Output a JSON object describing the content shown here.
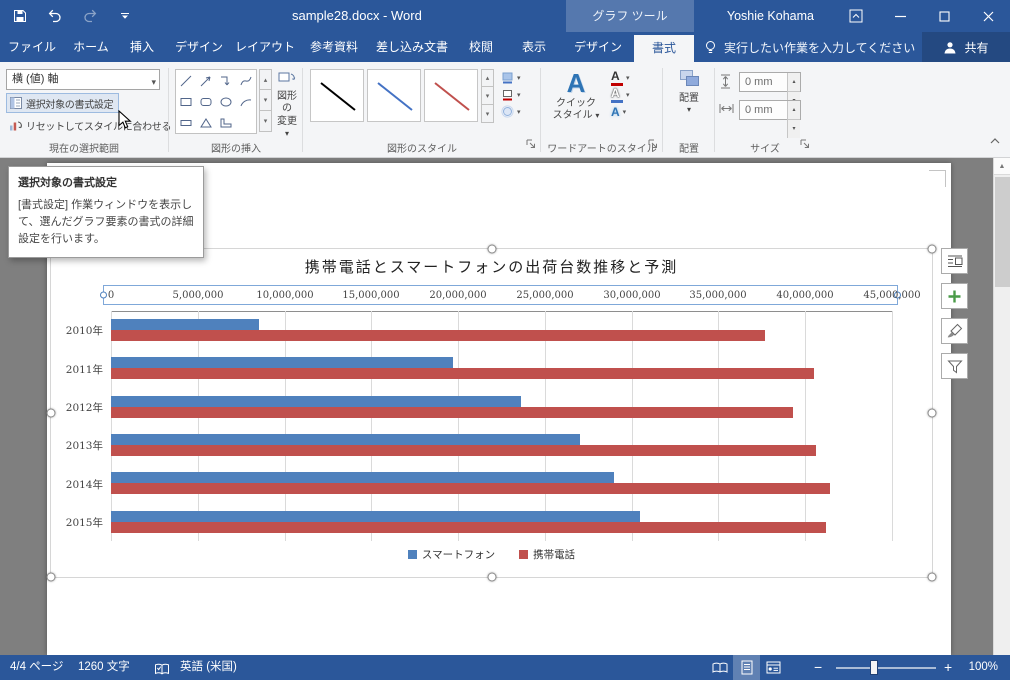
{
  "titlebar": {
    "title": "sample28.docx - Word",
    "contextual_header": "グラフ ツール",
    "user": "Yoshie Kohama"
  },
  "tabs": [
    {
      "label": "ファイル"
    },
    {
      "label": "ホーム"
    },
    {
      "label": "挿入"
    },
    {
      "label": "デザイン"
    },
    {
      "label": "レイアウト"
    },
    {
      "label": "参考資料"
    },
    {
      "label": "差し込み文書"
    },
    {
      "label": "校閲"
    },
    {
      "label": "表示"
    },
    {
      "label": "デザイン"
    },
    {
      "label": "書式"
    }
  ],
  "search": {
    "tell_me": "実行したい作業を入力してください"
  },
  "share": {
    "label": "共有"
  },
  "ribbon": {
    "current_selection": {
      "combo_value": "横 (値) 軸",
      "format_selection_label": "選択対象の書式設定",
      "reset_label": "リセットしてスタイルに合わせる",
      "group_label": "現在の選択範囲"
    },
    "insert_shapes": {
      "change_shape_line1": "図形の",
      "change_shape_line2": "変更",
      "group_label": "図形の挿入"
    },
    "shape_styles": {
      "group_label": "図形のスタイル",
      "preview_colors": [
        "#000000",
        "#4472C4",
        "#C0504D"
      ]
    },
    "wordart_styles": {
      "quick_line1": "クイック",
      "quick_line2": "スタイル",
      "group_label": "ワードアートのスタイル"
    },
    "arrange": {
      "button_label": "配置",
      "group_label": "配置"
    },
    "size": {
      "height_value": "0 mm",
      "width_value": "0 mm",
      "group_label": "サイズ"
    }
  },
  "tooltip": {
    "title": "選択対象の書式設定",
    "body": "[書式設定] 作業ウィンドウを表示して、選んだグラフ要素の書式の詳細設定を行います。"
  },
  "chart_data": {
    "type": "bar",
    "orientation": "horizontal",
    "title": "携帯電話とスマートフォンの出荷台数推移と予測",
    "categories": [
      "2010年",
      "2011年",
      "2012年",
      "2013年",
      "2014年",
      "2015年"
    ],
    "series": [
      {
        "name": "スマートフォン",
        "color": "#4F81BD",
        "values": [
          8500000,
          19700000,
          23600000,
          27000000,
          29000000,
          30500000
        ]
      },
      {
        "name": "携帯電話",
        "color": "#C0504D",
        "values": [
          37700000,
          40500000,
          39300000,
          40600000,
          41400000,
          41200000
        ]
      }
    ],
    "x_axis": {
      "min": 0,
      "max": 45000000,
      "tick_interval": 5000000,
      "tick_labels": [
        "0",
        "5,000,000",
        "10,000,000",
        "15,000,000",
        "20,000,000",
        "25,000,000",
        "30,000,000",
        "35,000,000",
        "40,000,000",
        "45,000,000"
      ]
    },
    "legend_position": "bottom",
    "gridlines": true
  },
  "statusbar": {
    "page": "4/4 ページ",
    "words": "1260 文字",
    "language": "英語 (米国)",
    "zoom_out": "−",
    "zoom_in": "+",
    "zoom_level": "100%"
  }
}
